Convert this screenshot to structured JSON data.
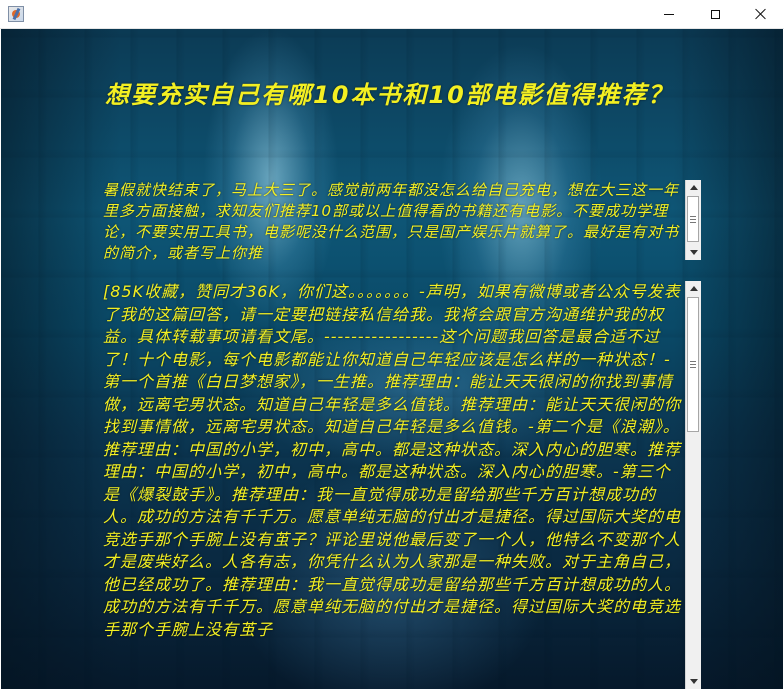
{
  "window": {
    "app_icon": "java-cup-icon",
    "controls": {
      "minimize_icon": "minimize-icon",
      "maximize_icon": "maximize-icon",
      "close_icon": "close-icon"
    }
  },
  "question": {
    "title": "想要充实自己有哪10本书和10部电影值得推荐？"
  },
  "description": {
    "text": "暑假就快结束了，马上大三了。感觉前两年都没怎么给自己充电，想在大三这一年里多方面接触，求知友们推荐10部或以上值得看的书籍还有电影。不要成功学理论，不要实用工具书，电影呢没什么范围，只是国产娱乐片就算了。最好是有对书的简介，或者写上你推"
  },
  "answer": {
    "text": "[85K收藏，赞同才36K，你们这。。。。。。。-声明，如果有微博或者公众号发表了我的这篇回答，请一定要把链接私信给我。我将会跟官方沟通维护我的权益。具体转载事项请看文尾。-----------------这个问题我回答是最合适不过了！十个电影，每个电影都能让你知道自己年轻应该是怎么样的一种状态！-第一个首推《白日梦想家》，一生推。推荐理由：能让天天很闲的你找到事情做，远离宅男状态。知道自己年轻是多么值钱。推荐理由：能让天天很闲的你找到事情做，远离宅男状态。知道自己年轻是多么值钱。-第二个是《浪潮》。推荐理由：中国的小学，初中，高中。都是这种状态。深入内心的胆寒。推荐理由：中国的小学，初中，高中。都是这种状态。深入内心的胆寒。-第三个是《爆裂鼓手》。推荐理由：我一直觉得成功是留给那些千方百计想成功的人。成功的方法有千千万。愿意单纯无脑的付出才是捷径。得过国际大奖的电竞选手那个手腕上没有茧子？评论里说他最后变了一个人，他特么不变那个人才是废柴好么。人各有志，你凭什么认为人家那是一种失败。对于主角自己，他已经成功了。推荐理由：我一直觉得成功是留给那些千方百计想成功的人。成功的方法有千千万。愿意单纯无脑的付出才是捷径。得过国际大奖的电竞选手那个手腕上没有茧子"
  }
}
